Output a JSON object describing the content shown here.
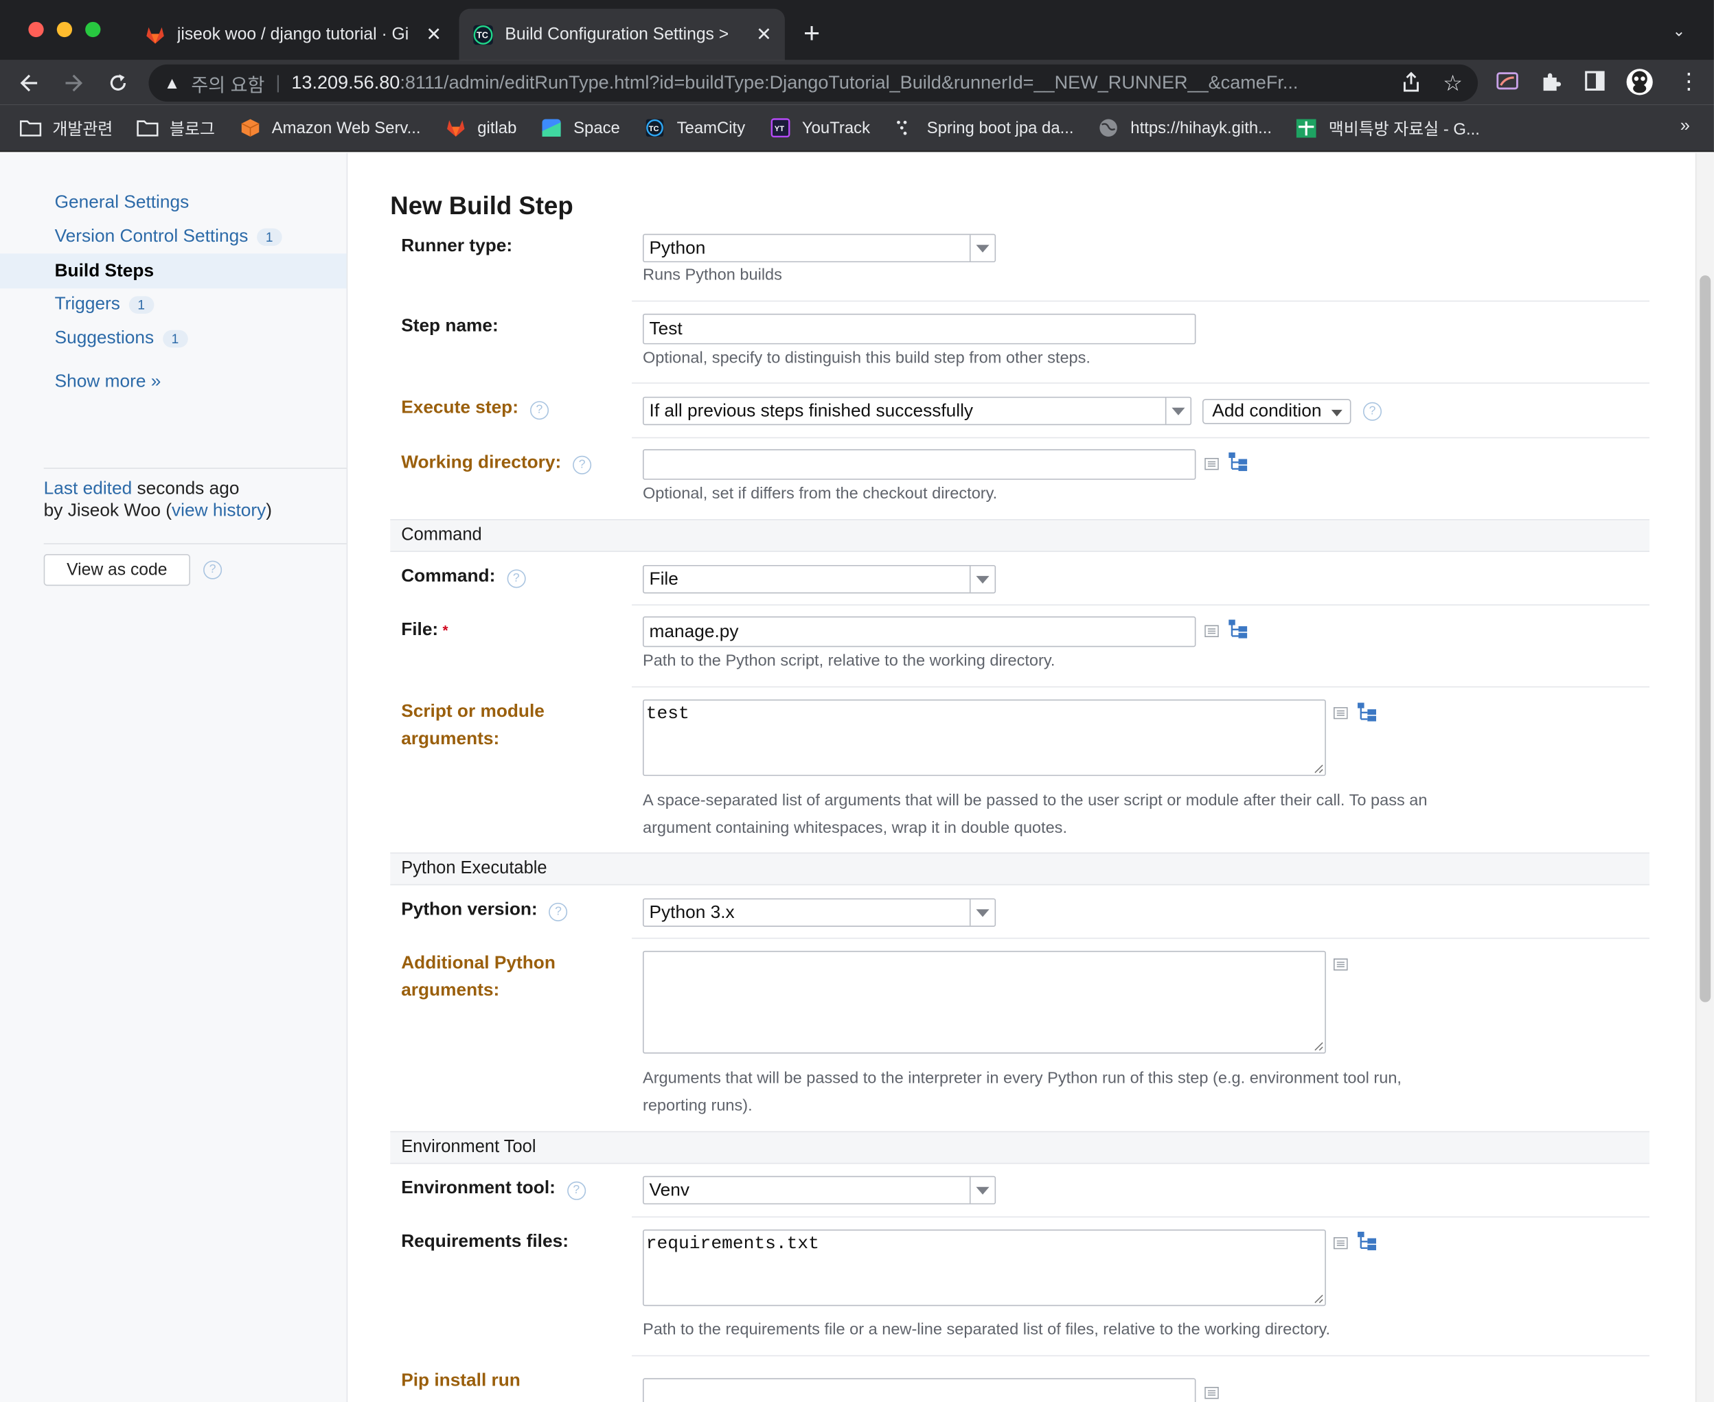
{
  "browser": {
    "tabs": [
      {
        "title": "jiseok woo / django tutorial · Gi",
        "close": "✕"
      },
      {
        "title": "Build Configuration Settings > ",
        "close": "✕"
      }
    ],
    "new_tab": "+",
    "tab_menu": "⌄",
    "address": {
      "warning_label": "주의 요함",
      "host": "13.209.56.80",
      "path": ":8111/admin/editRunType.html?id=buildType:DjangoTutorial_Build&runnerId=__NEW_RUNNER__&cameFr..."
    },
    "bookmarks": [
      {
        "label": "개발관련",
        "icon": "folder-icon"
      },
      {
        "label": "블로그",
        "icon": "folder-icon"
      },
      {
        "label": "Amazon Web Serv...",
        "icon": "aws-icon"
      },
      {
        "label": "gitlab",
        "icon": "gitlab-icon"
      },
      {
        "label": "Space",
        "icon": "space-icon"
      },
      {
        "label": "TeamCity",
        "icon": "teamcity-icon"
      },
      {
        "label": "YouTrack",
        "icon": "youtrack-icon"
      },
      {
        "label": "Spring boot jpa da...",
        "icon": "dots-icon"
      },
      {
        "label": "https://hihayk.gith...",
        "icon": "globe-icon"
      },
      {
        "label": "맥비특방 자료실 - G...",
        "icon": "sheets-icon"
      }
    ],
    "bookmarks_more": "»"
  },
  "sidebar": {
    "items": [
      {
        "label": "General Settings",
        "badge": ""
      },
      {
        "label": "Version Control Settings",
        "badge": "1"
      },
      {
        "label": "Build Steps",
        "badge": ""
      },
      {
        "label": "Triggers",
        "badge": "1"
      },
      {
        "label": "Suggestions",
        "badge": "1"
      }
    ],
    "show_more": "Show more »",
    "last_edited_link": "Last edited",
    "last_edited_rest": " seconds ago",
    "by_user": "by Jiseok Woo  (",
    "view_history": "view history",
    "close_paren": ")",
    "view_as_code": "View as code"
  },
  "form": {
    "title": "New Build Step",
    "runner_type": {
      "label": "Runner type:",
      "value": "Python",
      "hint": "Runs Python builds"
    },
    "step_name": {
      "label": "Step name:",
      "value": "Test",
      "hint": "Optional, specify to distinguish this build step from other steps."
    },
    "execute_step": {
      "label": "Execute step:",
      "value": "If all previous steps finished successfully",
      "add_condition": "Add condition"
    },
    "working_directory": {
      "label": "Working directory:",
      "value": "",
      "hint": "Optional, set if differs from the checkout directory."
    },
    "section_command": "Command",
    "command": {
      "label": "Command:",
      "value": "File"
    },
    "file": {
      "label": "File:",
      "required_mark": "*",
      "value": "manage.py",
      "hint": "Path to the Python script, relative to the working directory."
    },
    "script_args": {
      "label_line1": "Script or module",
      "label_line2": "arguments:",
      "value": "test",
      "hint_line1": "A space-separated list of arguments that will be passed to the user script or module after their call. To pass an",
      "hint_line2": "argument containing whitespaces, wrap it in double quotes."
    },
    "section_python": "Python Executable",
    "python_version": {
      "label": "Python version:",
      "value": "Python 3.x"
    },
    "additional_args": {
      "label_line1": "Additional Python",
      "label_line2": "arguments:",
      "value": "",
      "hint_line1": "Arguments that will be passed to the interpreter in every Python run of this step (e.g. environment tool run,",
      "hint_line2": "reporting runs)."
    },
    "section_env": "Environment Tool",
    "environment_tool": {
      "label": "Environment tool:",
      "value": "Venv"
    },
    "requirements_files": {
      "label": "Requirements files:",
      "value": "requirements.txt",
      "hint": "Path to the requirements file or a new-line separated list of files, relative to the working directory."
    },
    "pip_install_run": {
      "label": "Pip install run"
    }
  },
  "colors": {
    "link": "#2c6aa8",
    "modified_label": "#9a5f0c",
    "required": "#d0021b"
  }
}
